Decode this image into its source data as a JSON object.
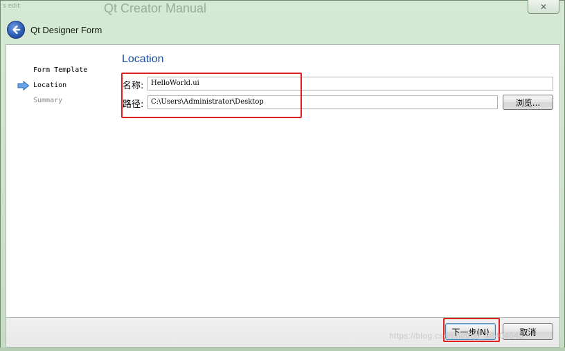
{
  "window": {
    "background_title": "Qt Creator Manual",
    "close_glyph": "✕"
  },
  "header": {
    "title": "Qt Designer Form",
    "back_icon": "back-arrow-icon"
  },
  "steps": [
    {
      "label": "Form Template",
      "state": "done"
    },
    {
      "label": "Location",
      "state": "current"
    },
    {
      "label": "Summary",
      "state": "pending"
    }
  ],
  "location": {
    "section_title": "Location",
    "name_label": "名称:",
    "name_value": "HelloWorld.ui",
    "path_label": "路径:",
    "path_value": "C:\\Users\\Administrator\\Desktop",
    "browse_label": "浏览..."
  },
  "footer": {
    "next_label": "下一步(N)",
    "cancel_label": "取消",
    "watermark": "https://blog.csdn.net/qq_38404645"
  },
  "colors": {
    "accent_title": "#1b4f9a",
    "highlight": "#e02020",
    "step_arrow": "#4a8ad8"
  }
}
